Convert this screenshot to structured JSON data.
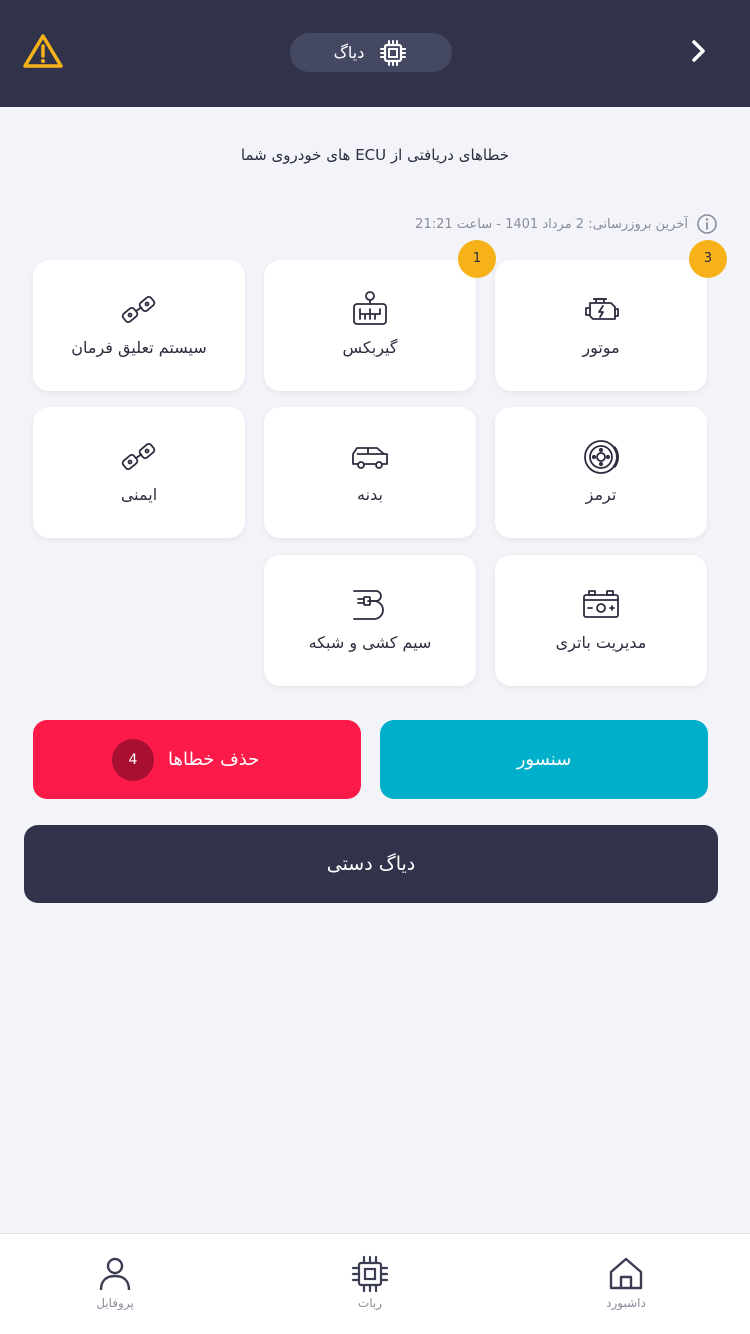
{
  "header": {
    "title": "دیاگ"
  },
  "intro": {
    "subtitle": "خطاهای دریافتی از ECU های خودروی شما",
    "last_update": "آخرین بروزرسانی:  2 مرداد 1401 - ساعت 21:21"
  },
  "categories": [
    {
      "label": "موتور",
      "icon": "engine-icon",
      "badge": "3"
    },
    {
      "label": "گیربکس",
      "icon": "gearbox-icon",
      "badge": "1"
    },
    {
      "label": "سیستم تعلیق فرمان",
      "icon": "seatbelt-icon",
      "badge": ""
    },
    {
      "label": "ترمز",
      "icon": "brake-disc-icon",
      "badge": ""
    },
    {
      "label": "بدنه",
      "icon": "car-body-icon",
      "badge": ""
    },
    {
      "label": "ایمنی",
      "icon": "seatbelt-icon",
      "badge": ""
    },
    {
      "label": "مدیریت باتری",
      "icon": "battery-icon",
      "badge": ""
    },
    {
      "label": "سیم کشی و شبکه",
      "icon": "plug-wire-icon",
      "badge": ""
    }
  ],
  "actions": {
    "sensor_label": "سنسور",
    "clear_label": "حذف خطاها",
    "clear_count": "4",
    "manual_label": "دیاگ دستی"
  },
  "nav": {
    "items": [
      {
        "label": "داشبورد",
        "icon": "home-icon"
      },
      {
        "label": "ربات",
        "icon": "chip-icon"
      },
      {
        "label": "پروفایل",
        "icon": "user-icon"
      }
    ]
  },
  "colors": {
    "header_bg": "#31334a",
    "warning": "#f7b21a",
    "sensor": "#00afca",
    "clear": "#fc1a49",
    "background": "#f3f4f9"
  }
}
